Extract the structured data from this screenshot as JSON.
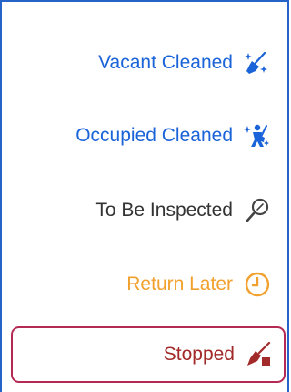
{
  "menu": {
    "items": [
      {
        "label": "Vacant Cleaned",
        "color": "#1a63d8",
        "icon": "broom-sparkle-icon"
      },
      {
        "label": "Occupied Cleaned",
        "color": "#1a63d8",
        "icon": "person-broom-icon"
      },
      {
        "label": "To Be Inspected",
        "color": "#333333",
        "icon": "magnifier-icon"
      },
      {
        "label": "Return Later",
        "color": "#f2a12e",
        "icon": "clock-alert-icon"
      },
      {
        "label": "Stopped",
        "color": "#a32a2a",
        "icon": "broom-stop-icon",
        "selected": true
      }
    ]
  }
}
